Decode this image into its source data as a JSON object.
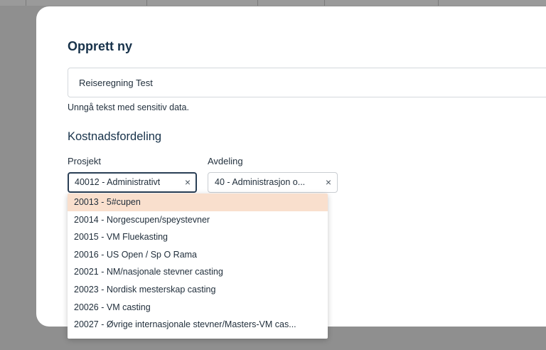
{
  "modal": {
    "title": "Opprett ny",
    "name_value": "Reiseregning Test",
    "hint": "Unngå tekst med sensitiv data.",
    "section_title": "Kostnadsfordeling"
  },
  "project": {
    "label": "Prosjekt",
    "value": "40012 - Administrativt",
    "clear": "×"
  },
  "department": {
    "label": "Avdeling",
    "value": "40 - Administrasjon o...",
    "clear": "×"
  },
  "dropdown": {
    "highlight_color": "#f9dfcd",
    "options": [
      "20013 - 5#cupen",
      "20014 - Norgescupen/speystevner",
      "20015 - VM Fluekasting",
      "20016 - US Open / Sp O Rama",
      "20021 - NM/nasjonale stevner casting",
      "20023 - Nordisk mesterskap casting",
      "20026 - VM casting",
      "20027 - Øvrige internasjonale stevner/Masters-VM cas..."
    ]
  }
}
